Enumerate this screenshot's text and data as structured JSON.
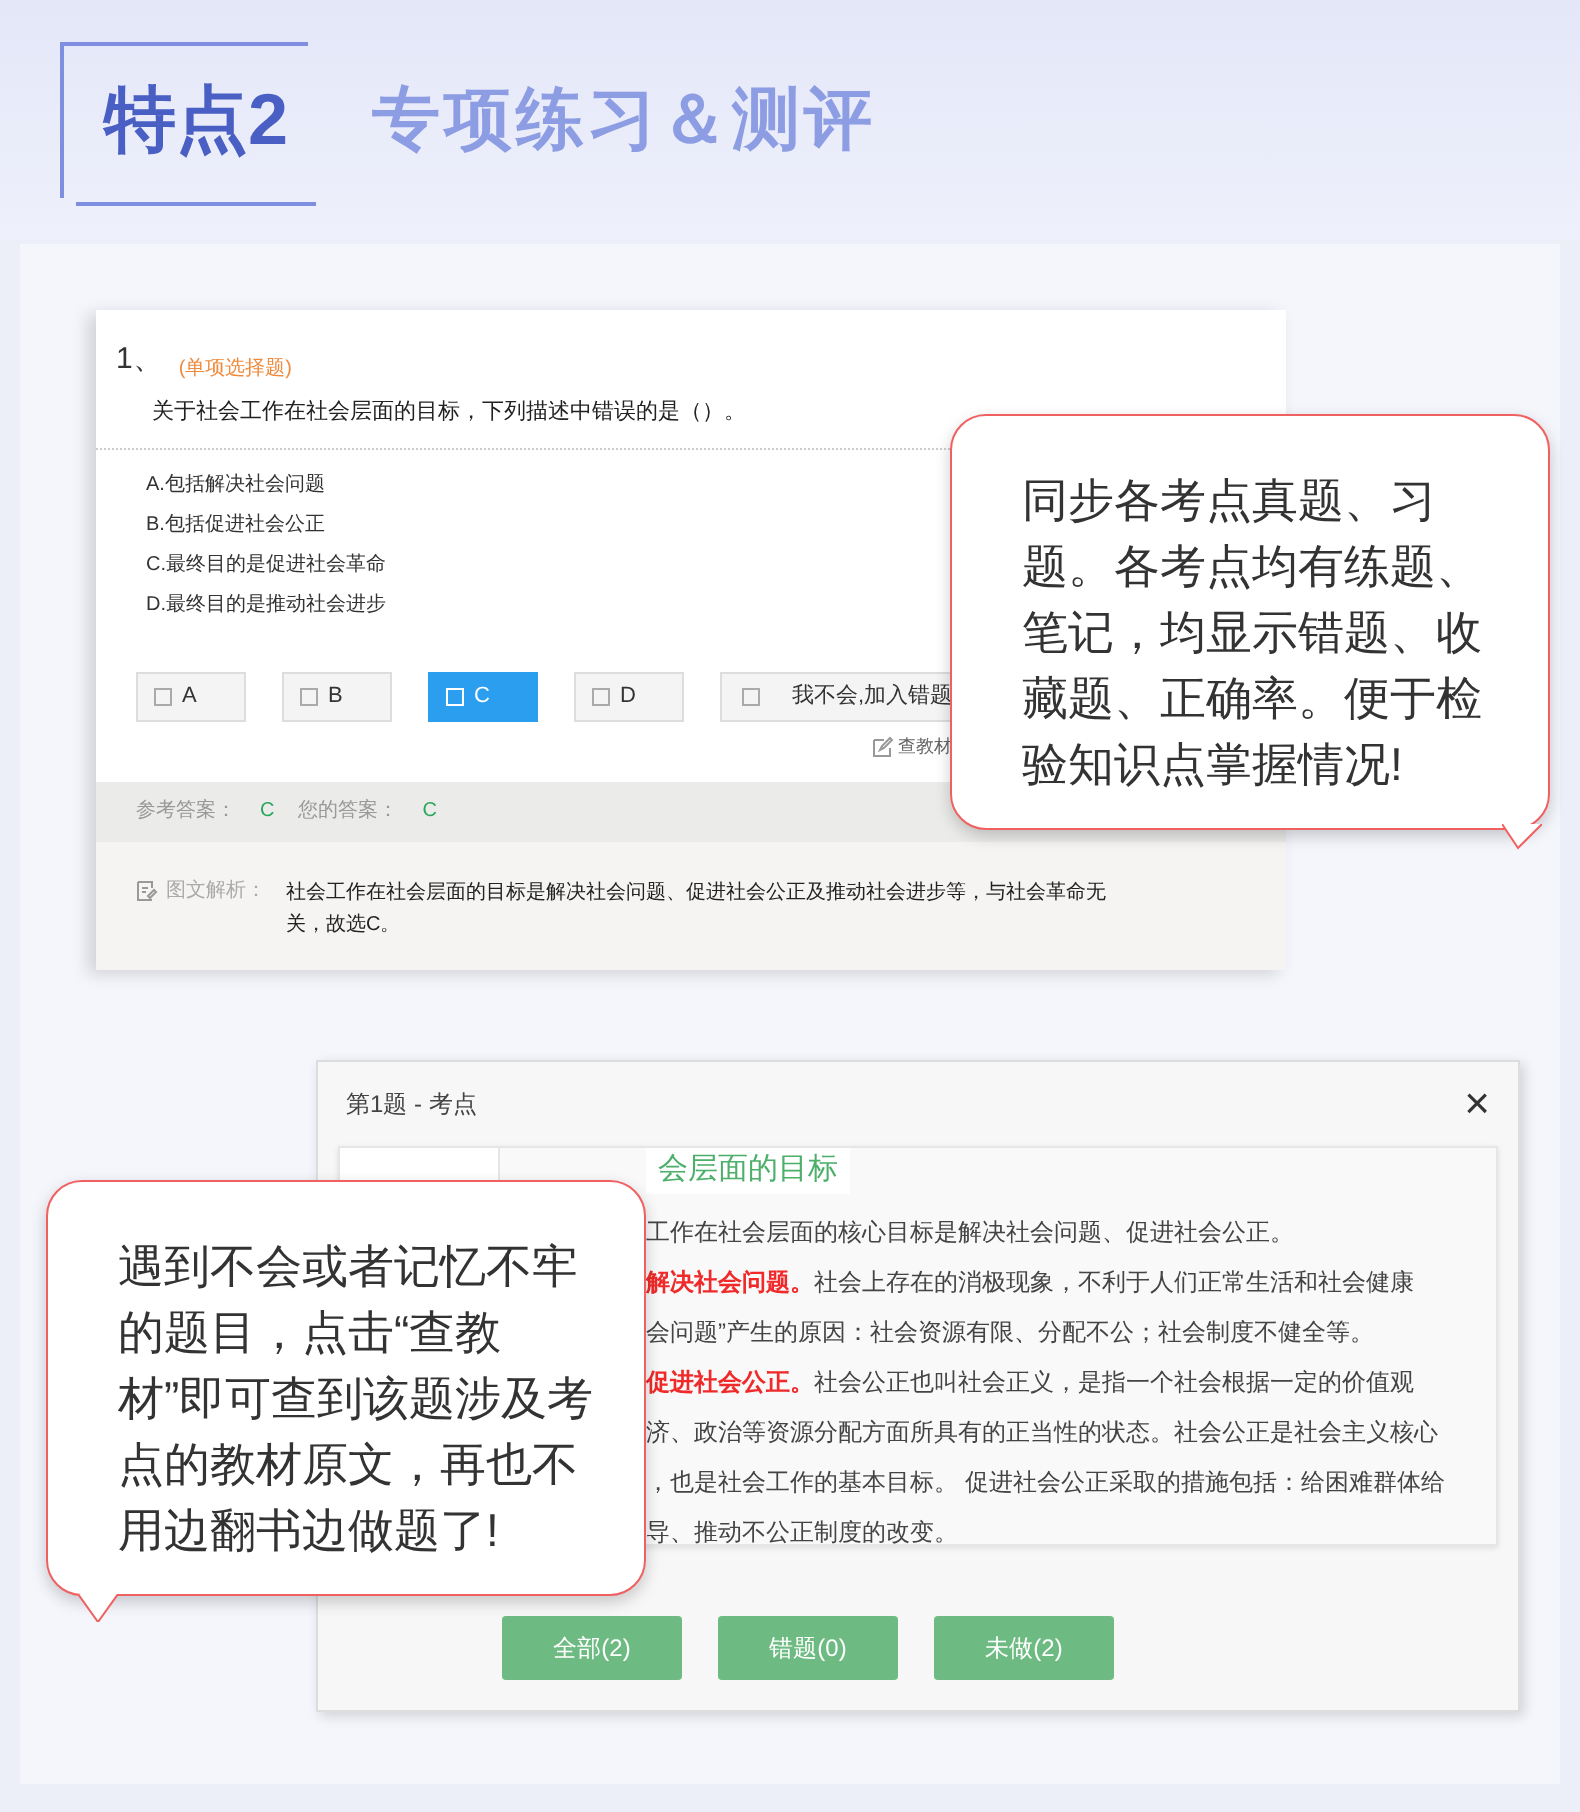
{
  "header": {
    "badge": "特点2",
    "title": "专项练习＆测评"
  },
  "question": {
    "number": "1、",
    "type": "(单项选择题)",
    "text": "关于社会工作在社会层面的目标，下列描述中错误的是（）。",
    "options": [
      "A.包括解决社会问题",
      "B.包括促进社会公正",
      "C.最终目的是促进社会革命",
      "D.最终目的是推动社会进步"
    ],
    "answer_buttons": [
      {
        "label": "A",
        "selected": false
      },
      {
        "label": "B",
        "selected": false
      },
      {
        "label": "C",
        "selected": true
      },
      {
        "label": "D",
        "selected": false
      }
    ],
    "skip_button": "我不会,加入错题",
    "textbook_link": "查教材",
    "reference_label": "参考答案：",
    "reference_answer": "C",
    "your_label": "您的答案：",
    "your_answer": "C",
    "analysis_label": "图文解析：",
    "analysis": "社会工作在社会层面的目标是解决社会问题、促进社会公正及推动社会进步等，与社会革命无关，故选C。"
  },
  "callouts": [
    {
      "text": "同步各考点真题、习题。各考点均有练题、笔记，均显示错题、收藏题、正确率。便于检验知识点掌握情况!"
    },
    {
      "text": "遇到不会或者记忆不牢的题目，点击“查教材”即可查到该题涉及考点的教材原文，再也不用边翻书边做题了!"
    }
  ],
  "dialog": {
    "title": "第1题 - 考点",
    "close": "×",
    "section_title": "会层面的目标",
    "lines": [
      {
        "text": "工作在社会层面的核心目标是解决社会问题、促进社会公正。"
      },
      {
        "lead": "解决社会问题。",
        "text": "社会上存在的消极现象，不利于人们正常生活和社会健康"
      },
      {
        "text": "会问题”产生的原因：社会资源有限、分配不公；社会制度不健全等。"
      },
      {
        "lead": "促进社会公正。",
        "text": "社会公正也叫社会正义，是指一个社会根据一定的价值观"
      },
      {
        "text": "济、政治等资源分配方面所具有的正当性的状态。社会公正是社会主义核心"
      },
      {
        "text": "，也是社会工作的基本目标。 促进社会公正采取的措施包括：给困难群体给"
      },
      {
        "text": "导、推动不公正制度的改变。"
      }
    ],
    "filters": [
      "全部(2)",
      "错题(0)",
      "未做(2)"
    ]
  }
}
